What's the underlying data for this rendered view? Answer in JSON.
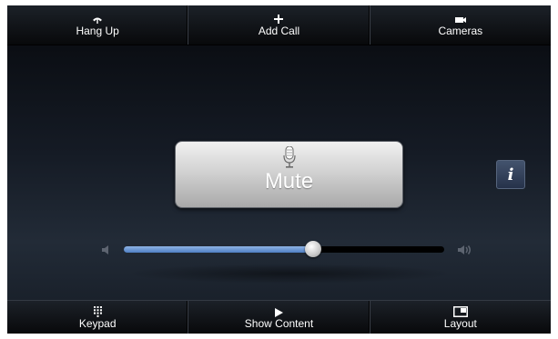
{
  "top_toolbar": {
    "buttons": [
      {
        "label": "Hang Up",
        "icon": "phone-hangup-icon"
      },
      {
        "label": "Add Call",
        "icon": "plus-icon"
      },
      {
        "label": "Cameras",
        "icon": "camera-icon"
      }
    ]
  },
  "main": {
    "mute_label": "Mute",
    "mute_icon": "microphone-icon",
    "info_icon": "info-icon",
    "volume": {
      "level_percent": 59,
      "low_icon": "volume-low-icon",
      "high_icon": "volume-high-icon",
      "fill_color": "#5b8bd0"
    }
  },
  "bottom_toolbar": {
    "buttons": [
      {
        "label": "Keypad",
        "icon": "keypad-icon"
      },
      {
        "label": "Show Content",
        "icon": "play-icon"
      },
      {
        "label": "Layout",
        "icon": "layout-icon"
      }
    ]
  },
  "colors": {
    "background": "#151b25",
    "toolbar": "#0d0f12",
    "mute_button": "#d2d2d2",
    "info_button": "#34425c",
    "accent": "#5b8bd0"
  }
}
